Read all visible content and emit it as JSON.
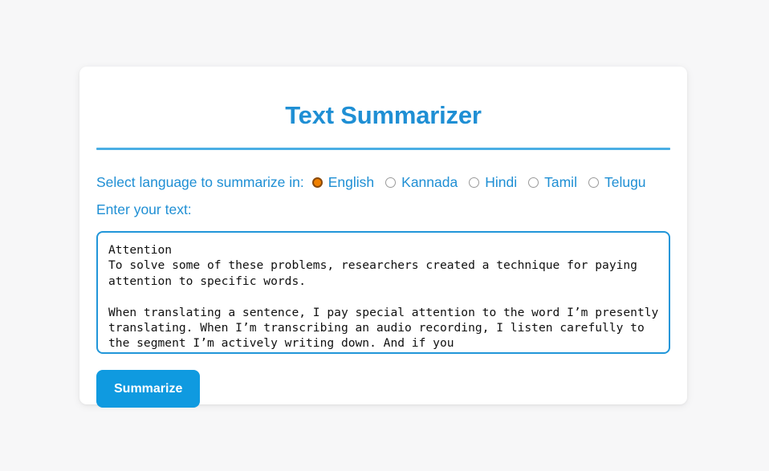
{
  "app": {
    "title": "Text Summarizer",
    "background_color": "#f7f7f8",
    "accent_color": "#1f8fd4"
  },
  "form": {
    "language_prompt": "Select language to summarize in:",
    "languages": [
      {
        "label": "English",
        "selected": true
      },
      {
        "label": "Kannada",
        "selected": false
      },
      {
        "label": "Hindi",
        "selected": false
      },
      {
        "label": "Tamil",
        "selected": false
      },
      {
        "label": "Telugu",
        "selected": false
      }
    ],
    "text_label": "Enter your text:",
    "textarea": {
      "value": "Attention\nTo solve some of these problems, researchers created a technique for paying attention to specific words.\n\nWhen translating a sentence, I pay special attention to the word I’m presently translating. When I’m transcribing an audio recording, I listen carefully to the segment I’m actively writing down. And if you",
      "placeholder": "",
      "border_color": "#2196d9"
    },
    "submit_label": "Summarize",
    "submit_color": "#0f9ae0"
  }
}
